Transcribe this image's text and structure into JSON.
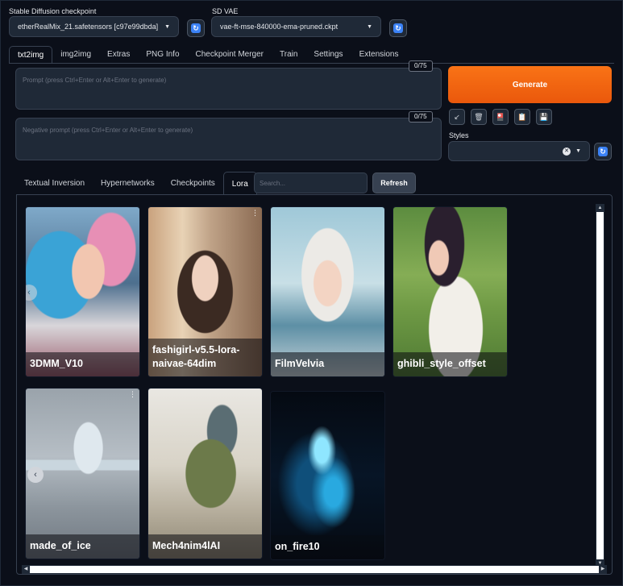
{
  "checkpoint": {
    "label": "Stable Diffusion checkpoint",
    "value": "etherRealMix_21.safetensors [c97e99dbda]"
  },
  "vae": {
    "label": "SD VAE",
    "value": "vae-ft-mse-840000-ema-pruned.ckpt"
  },
  "main_tabs": [
    "txt2img",
    "img2img",
    "Extras",
    "PNG Info",
    "Checkpoint Merger",
    "Train",
    "Settings",
    "Extensions"
  ],
  "prompt": {
    "placeholder": "Prompt (press Ctrl+Enter or Alt+Enter to generate)",
    "counter": "0/75"
  },
  "negative_prompt": {
    "placeholder": "Negative prompt (press Ctrl+Enter or Alt+Enter to generate)",
    "counter": "0/75"
  },
  "generate_label": "Generate",
  "tools": [
    {
      "icon": "arrow-icon",
      "glyph": "↙"
    },
    {
      "icon": "trash-icon",
      "glyph": "🗑"
    },
    {
      "icon": "extra-networks-icon",
      "glyph": "🎴"
    },
    {
      "icon": "clipboard-icon",
      "glyph": "📋"
    },
    {
      "icon": "save-icon",
      "glyph": "💾"
    }
  ],
  "styles": {
    "label": "Styles",
    "clear_glyph": "✕"
  },
  "network_tabs": [
    "Textual Inversion",
    "Hypernetworks",
    "Checkpoints",
    "Lora"
  ],
  "search": {
    "placeholder": "Search..."
  },
  "refresh_label": "Refresh",
  "cards": [
    {
      "name": "3DMM_V10"
    },
    {
      "name": "fashigirl-v5.5-lora-naivae-64dim"
    },
    {
      "name": "FilmVelvia"
    },
    {
      "name": "ghibli_style_offset"
    },
    {
      "name": "made_of_ice"
    },
    {
      "name": "Mech4nim4lAI"
    },
    {
      "name": "on_fire10"
    }
  ],
  "colors": {
    "background": "#0b0f19",
    "panel": "#1f2937",
    "accent_orange": "#f97316",
    "refresh_blue": "#3b82f6"
  }
}
